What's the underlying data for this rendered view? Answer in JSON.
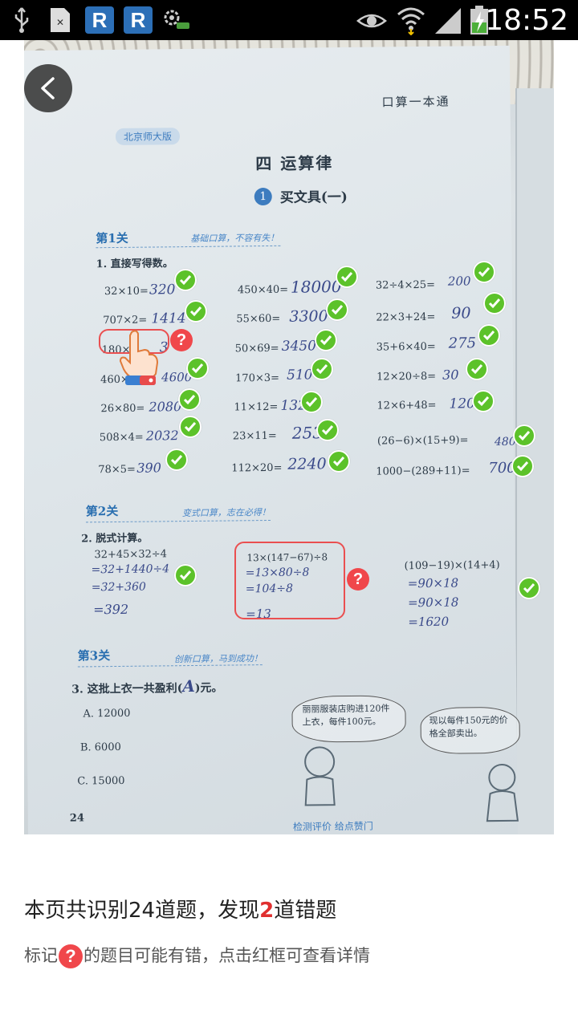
{
  "status_bar": {
    "time": "18:52",
    "app_badge_1": "R",
    "app_badge_2": "R",
    "icons": [
      "usb-icon",
      "sim-icon",
      "r-app-icon",
      "r-app-icon",
      "gear-icon",
      "eye-icon",
      "wifi-icon",
      "signal-icon",
      "battery-icon"
    ]
  },
  "photo": {
    "header_right": "口算一本通",
    "edition_tag": "北京师大版",
    "chapter": "四  运算律",
    "lesson_num": "1",
    "lesson": "买文具(一)",
    "section1": {
      "label": "第1关",
      "note": "基础口算，不容有失！",
      "task": "1. 直接写得数。"
    },
    "section2": {
      "label": "第2关",
      "note": "变式口算，志在必得！",
      "task": "2. 脱式计算。"
    },
    "section3": {
      "label": "第3关",
      "note": "创新口算，马到成功！",
      "task": "3. 这批上衣一共盈利(",
      "task_end": ")元。",
      "answer": "A"
    },
    "col1": [
      {
        "q": "32×10=",
        "a": "320"
      },
      {
        "q": "707×2=",
        "a": "1414"
      },
      {
        "q": "180×",
        "a": "3"
      },
      {
        "q": "460×",
        "a": "4600"
      },
      {
        "q": "26×80=",
        "a": "2080"
      },
      {
        "q": "508×4=",
        "a": "2032"
      },
      {
        "q": "78×5=",
        "a": "390"
      }
    ],
    "col2": [
      {
        "q": "450×40=",
        "a": "18000"
      },
      {
        "q": "55×60=",
        "a": "3300"
      },
      {
        "q": "50×69=",
        "a": "3450"
      },
      {
        "q": "170×3=",
        "a": "510"
      },
      {
        "q": "11×12=",
        "a": "132"
      },
      {
        "q": "23×11=",
        "a": "253"
      },
      {
        "q": "112×20=",
        "a": "2240"
      }
    ],
    "col3": [
      {
        "q": "32÷4×25=",
        "a": "200"
      },
      {
        "q": "22×3+24=",
        "a": "90"
      },
      {
        "q": "35+6×40=",
        "a": "275"
      },
      {
        "q": "12×20÷8=",
        "a": "30"
      },
      {
        "q": "12×6+48=",
        "a": "120"
      },
      {
        "q": "(26−6)×(15+9)=",
        "a": "480"
      },
      {
        "q": "1000−(289+11)=",
        "a": "700"
      }
    ],
    "calc1": {
      "q": "32+45×32÷4",
      "steps": [
        "=32+1440÷4",
        "=32+360",
        "=392"
      ]
    },
    "calc2": {
      "q": "13×(147−67)÷8",
      "steps": [
        "=13×80÷8",
        "=104÷8",
        "=13"
      ]
    },
    "calc3": {
      "q": "(109−19)×(14+4)",
      "steps": [
        "=90×18",
        "=90×18",
        "=1620"
      ]
    },
    "options": [
      "A. 12000",
      "B. 6000",
      "C. 15000"
    ],
    "bubble1": "丽丽服装店购进120件上衣，每件100元。",
    "bubble2": "现以每件150元的价格全部卖出。",
    "page_num": "24",
    "bottom_text": "检测评价    给点赞门"
  },
  "footer": {
    "title_prefix": "本页共识别24道题，发现",
    "error_count": "2",
    "title_suffix": "道错题",
    "hint_prefix": "标记",
    "hint_icon": "?",
    "hint_suffix": "的题目可能有错，点击红框可查看详情"
  },
  "colors": {
    "check": "#5cc22a",
    "error": "#f0474b",
    "error_text": "#e02f2f"
  }
}
